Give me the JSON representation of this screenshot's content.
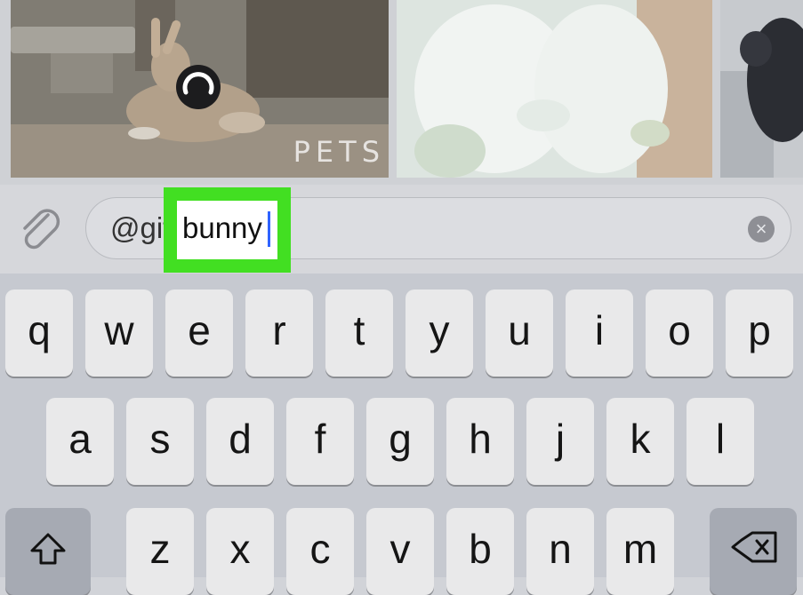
{
  "gif_results": {
    "items": [
      {
        "name": "bunny-gif-1",
        "watermark": "PETS"
      },
      {
        "name": "bunny-gif-2"
      },
      {
        "name": "bunny-gif-3"
      }
    ]
  },
  "input": {
    "prefix": "@gif",
    "query": "bunny"
  },
  "icons": {
    "attach": "paperclip-icon",
    "clear": "clear-icon",
    "loading": "loading-spinner-icon",
    "shift": "shift-icon",
    "delete": "backspace-icon"
  },
  "keyboard": {
    "row1": [
      "q",
      "w",
      "e",
      "r",
      "t",
      "y",
      "u",
      "i",
      "o",
      "p"
    ],
    "row2": [
      "a",
      "s",
      "d",
      "f",
      "g",
      "h",
      "j",
      "k",
      "l"
    ],
    "row3": [
      "z",
      "x",
      "c",
      "v",
      "b",
      "n",
      "m"
    ]
  },
  "colors": {
    "highlight": "#42df22",
    "caret": "#2f63ff"
  }
}
